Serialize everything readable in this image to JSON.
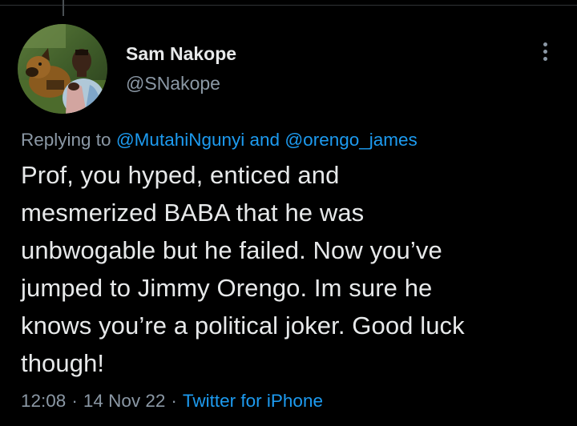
{
  "tweet": {
    "author": {
      "display_name": "Sam Nakope",
      "handle": "@SNakope"
    },
    "reply_context": {
      "prefix": "Replying to",
      "mention_1": "@MutahiNgunyi",
      "conjunction": "and",
      "mention_2": "@orengo_james"
    },
    "text_lines": [
      "Prof, you hyped, enticed and",
      "mesmerized BABA that he was",
      "unbwogable but he failed. Now you’ve",
      "jumped to Jimmy Orengo. Im sure he",
      "knows you’re a political joker. Good luck",
      "though!"
    ],
    "time": "12:08",
    "separator": "·",
    "date": "14 Nov 22",
    "source": "Twitter for iPhone"
  },
  "icons": {
    "more": "more-vertical-icon"
  },
  "colors": {
    "background": "#000000",
    "primary_text": "#e7e9ea",
    "secondary_text": "#8b98a5",
    "link": "#1d9bf0"
  }
}
